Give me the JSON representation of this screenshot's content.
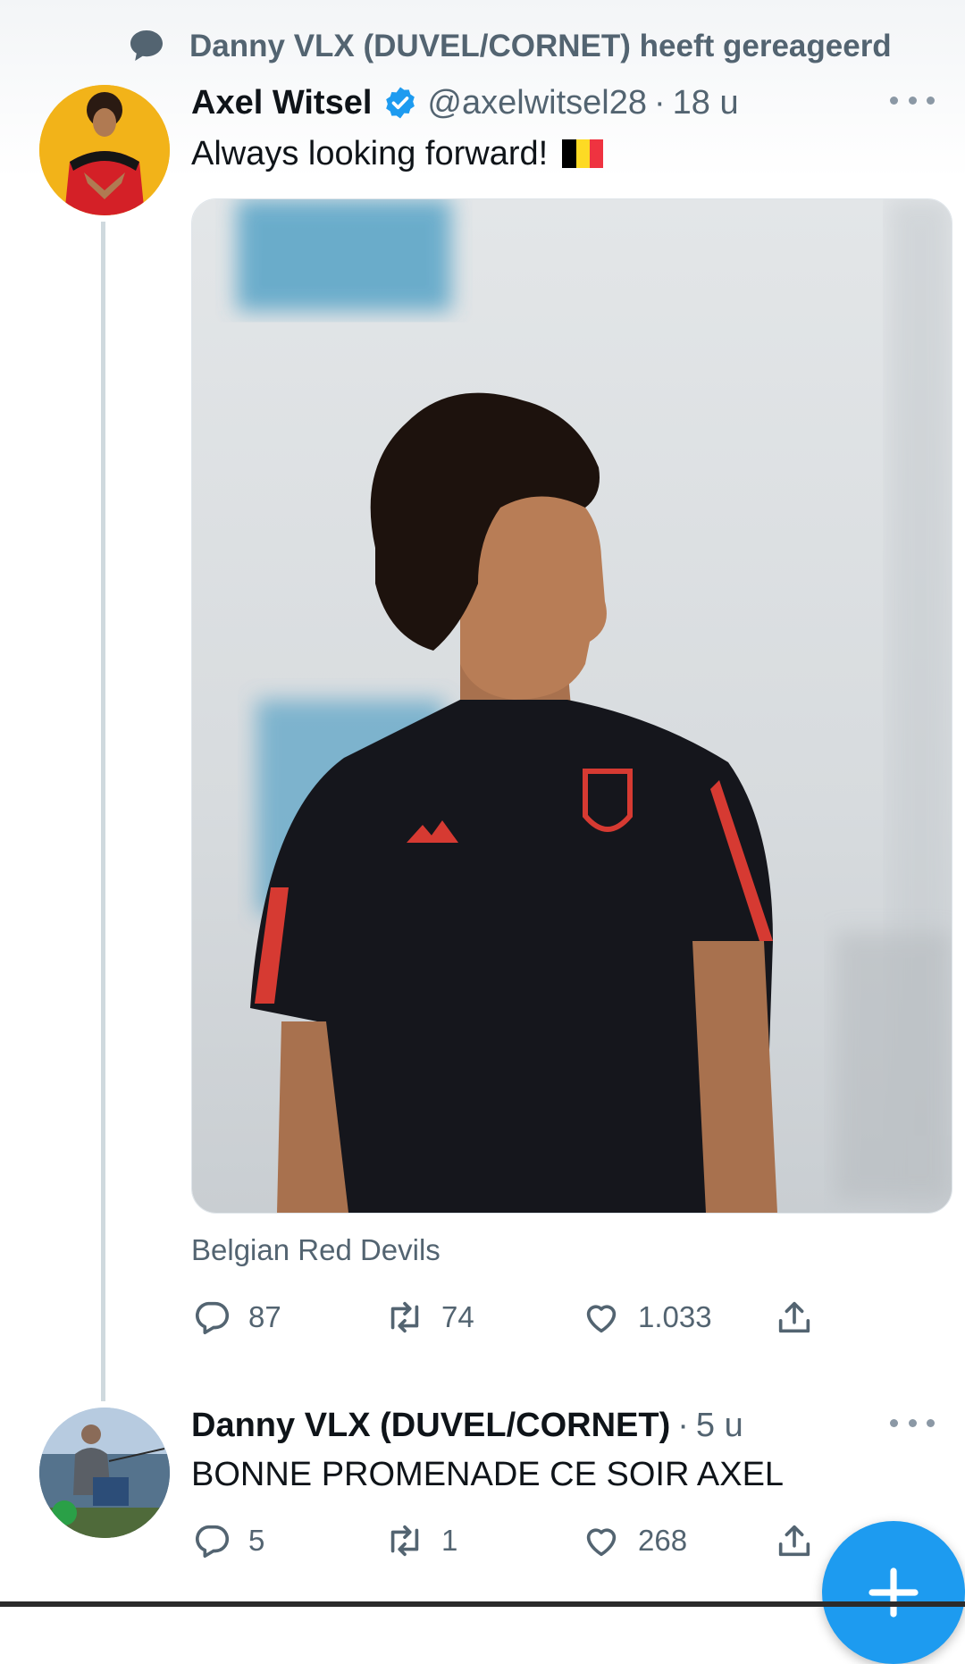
{
  "context": {
    "text": "Danny VLX (DUVEL/CORNET) heeft gereageerd",
    "icon": "speech-bubble-icon"
  },
  "tweet": {
    "author_name": "Axel Witsel",
    "verified": true,
    "handle": "@axelwitsel28",
    "separator": "·",
    "time": "18 u",
    "text": "Always looking forward!",
    "emoji": "flag-belgium",
    "photo_tag": "Belgian Red Devils",
    "stats": {
      "replies": "87",
      "retweets": "74",
      "likes": "1.033"
    }
  },
  "reply": {
    "author_name": "Danny VLX (DUVEL/CORNET)",
    "separator": "·",
    "time": "5 u",
    "text": "BONNE PROMENADE CE SOIR AXEL",
    "stats": {
      "replies": "5",
      "retweets": "1",
      "likes": "268"
    }
  },
  "colors": {
    "accent": "#1d9bf0",
    "secondary_text": "#536471",
    "primary_text": "#0f1419",
    "flag": [
      "#000000",
      "#fdda24",
      "#ef3340"
    ]
  }
}
